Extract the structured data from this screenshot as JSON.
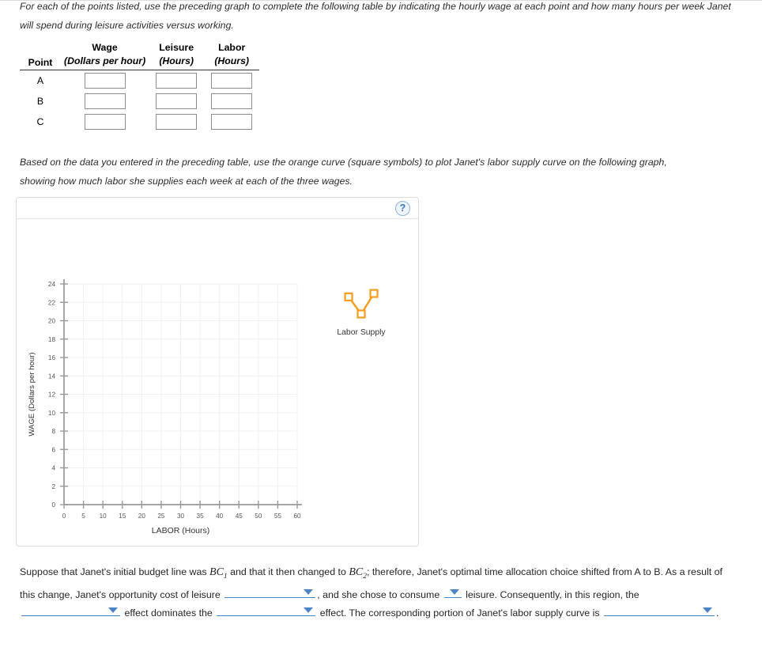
{
  "intro": {
    "text": "For each of the points listed, use the preceding graph to complete the following table by indicating the hourly wage at each point and how many hours per week Janet will spend during leisure activities versus working."
  },
  "table": {
    "headers_top": [
      "",
      "Wage",
      "Leisure",
      "Labor"
    ],
    "headers_units": [
      "Point",
      "(Dollars per hour)",
      "(Hours)",
      "(Hours)"
    ],
    "rows": [
      {
        "point": "A",
        "wage": "",
        "leisure": "",
        "labor": ""
      },
      {
        "point": "B",
        "wage": "",
        "leisure": "",
        "labor": ""
      },
      {
        "point": "C",
        "wage": "",
        "leisure": "",
        "labor": ""
      }
    ],
    "input_placeholder": ""
  },
  "plot_instruction": {
    "text": "Based on the data you entered in the preceding table, use the orange curve (square symbols) to plot Janet's labor supply curve on the following graph, showing how much labor she supplies each week at each of the three wages."
  },
  "graph_panel": {
    "help_label": "?"
  },
  "chart_data": {
    "type": "line",
    "title": "",
    "xlabel": "LABOR (Hours)",
    "ylabel": "WAGE (Dollars per hour)",
    "xlim": [
      0,
      60
    ],
    "ylim": [
      0,
      24
    ],
    "xticks": [
      0,
      5,
      10,
      15,
      20,
      25,
      30,
      35,
      40,
      45,
      50,
      55,
      60
    ],
    "yticks": [
      0,
      2,
      4,
      6,
      8,
      10,
      12,
      14,
      16,
      18,
      20,
      22,
      24
    ],
    "xtick_labels": [
      "0",
      "5",
      "10",
      "15",
      "20",
      "25",
      "30",
      "35",
      "40",
      "45",
      "50",
      "55",
      "60"
    ],
    "ytick_labels": [
      "0",
      "2",
      "4",
      "6",
      "8",
      "10",
      "12",
      "14",
      "16",
      "18",
      "20",
      "22",
      "24"
    ],
    "grid": true,
    "legend_position": "right",
    "series": [
      {
        "name": "Labor Supply",
        "color": "#F59B1E",
        "marker": "square",
        "values": [],
        "x": [],
        "plotted": false
      }
    ],
    "legend_glyph_points": [
      {
        "x": 0,
        "y": 1
      },
      {
        "x": 0.5,
        "y": 0
      },
      {
        "x": 1,
        "y": 1.2
      }
    ]
  },
  "closing": {
    "s1": "Suppose that Janet's initial budget line was",
    "bc1": "BC",
    "bc1_sub": "1",
    "s2": "and that it then changed to",
    "bc2": "BC",
    "bc2_sub": "2",
    "s3": "; therefore, Janet's optimal time allocation choice shifted from A to B. As a result of this change, Janet's opportunity cost of leisure",
    "s4": ", and she chose to consume",
    "s5": "leisure. Consequently, in this region, the",
    "s6": "effect dominates the",
    "s7": "effect. The corresponding portion of Janet's labor supply curve is",
    "s8": ".",
    "dropdown_value_1": "",
    "dropdown_value_2": "",
    "dropdown_value_3": "",
    "dropdown_value_4": "",
    "dropdown_value_5": ""
  },
  "colors": {
    "accent_orange": "#F59B1E",
    "dropdown_blue": "#4a86c5",
    "axis_gray": "#999999",
    "grid_gray": "#f1f1f1",
    "panel_border": "#d8dde3"
  }
}
